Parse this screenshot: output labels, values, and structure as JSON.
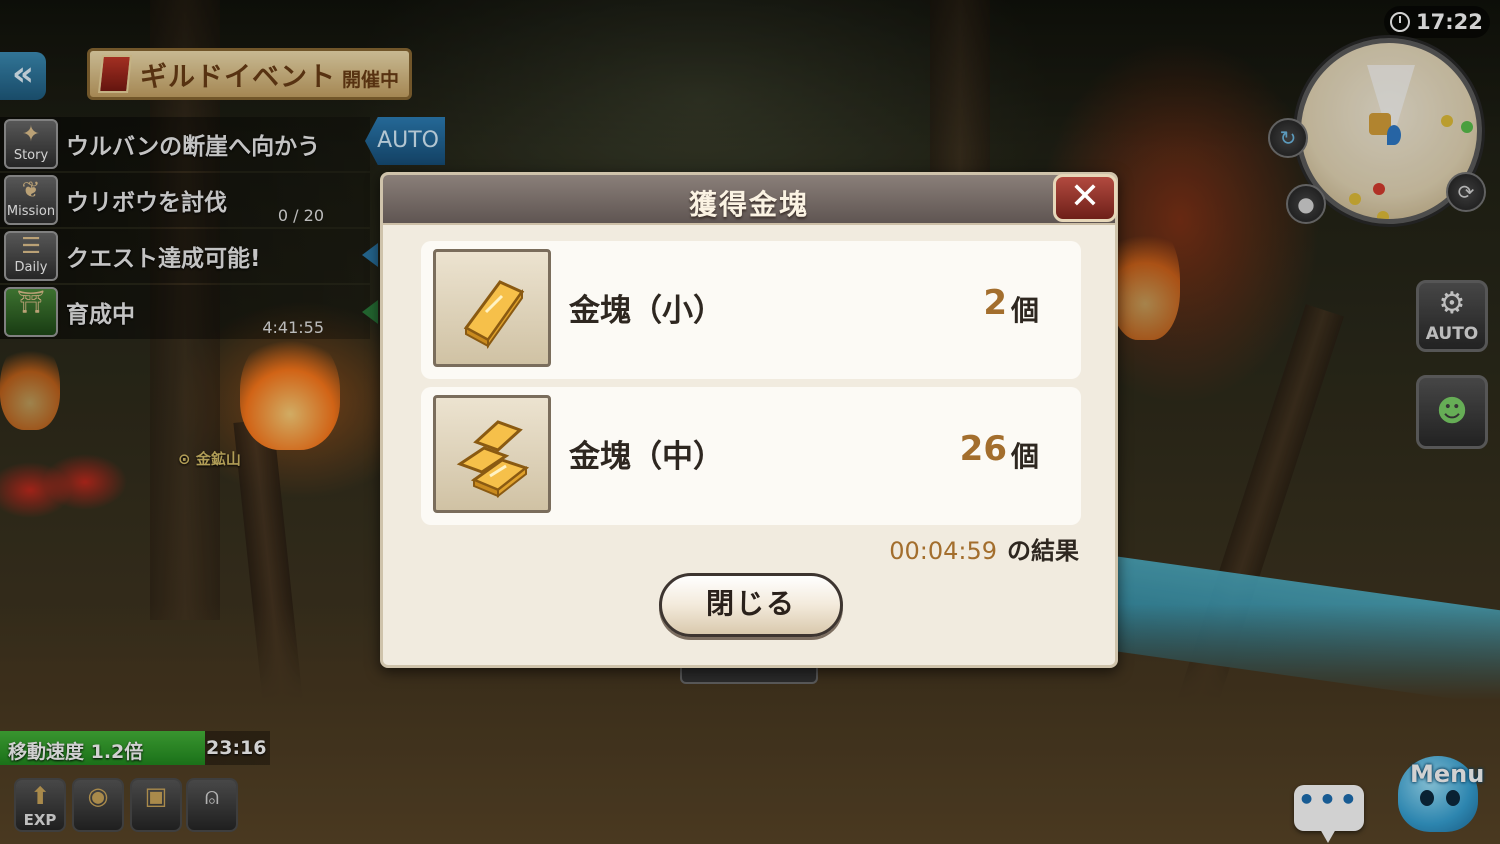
{
  "guild_event": {
    "title": "ギルドイベント",
    "status": "開催中"
  },
  "quests": [
    {
      "category": "Story",
      "text": "ウルバンの断崖へ向かう",
      "action": "AUTO"
    },
    {
      "category": "Mission",
      "text": "ウリボウを討伐",
      "progress": "0 / 20"
    },
    {
      "category": "Daily",
      "text": "クエスト達成可能!"
    },
    {
      "category": "",
      "text": "育成中",
      "timer": "4:41:55"
    }
  ],
  "map_label": "金鉱山",
  "clock": "17:22",
  "speed_buff": {
    "label": "移動速度 1.2倍",
    "time": "23:16",
    "fill_fraction": 0.76
  },
  "bottom_buttons": [
    "EXP",
    "",
    "",
    ""
  ],
  "right_buttons": {
    "auto_label": "AUTO"
  },
  "menu_label": "Menu",
  "dialog": {
    "title": "獲得金塊",
    "items": [
      {
        "name": "金塊（小）",
        "count": "2",
        "unit": "個",
        "icon": "gold-bar-small-icon"
      },
      {
        "name": "金塊（中）",
        "count": "26",
        "unit": "個",
        "icon": "gold-bar-stack-icon"
      }
    ],
    "result_time": "00:04:59",
    "result_suffix": "の結果",
    "close_button_label": "閉じる"
  },
  "colors": {
    "accent_gold": "#a36e2d",
    "header": "#6e6461",
    "close_red": "#9a3a30",
    "speed_green": "#2f9e2a"
  }
}
